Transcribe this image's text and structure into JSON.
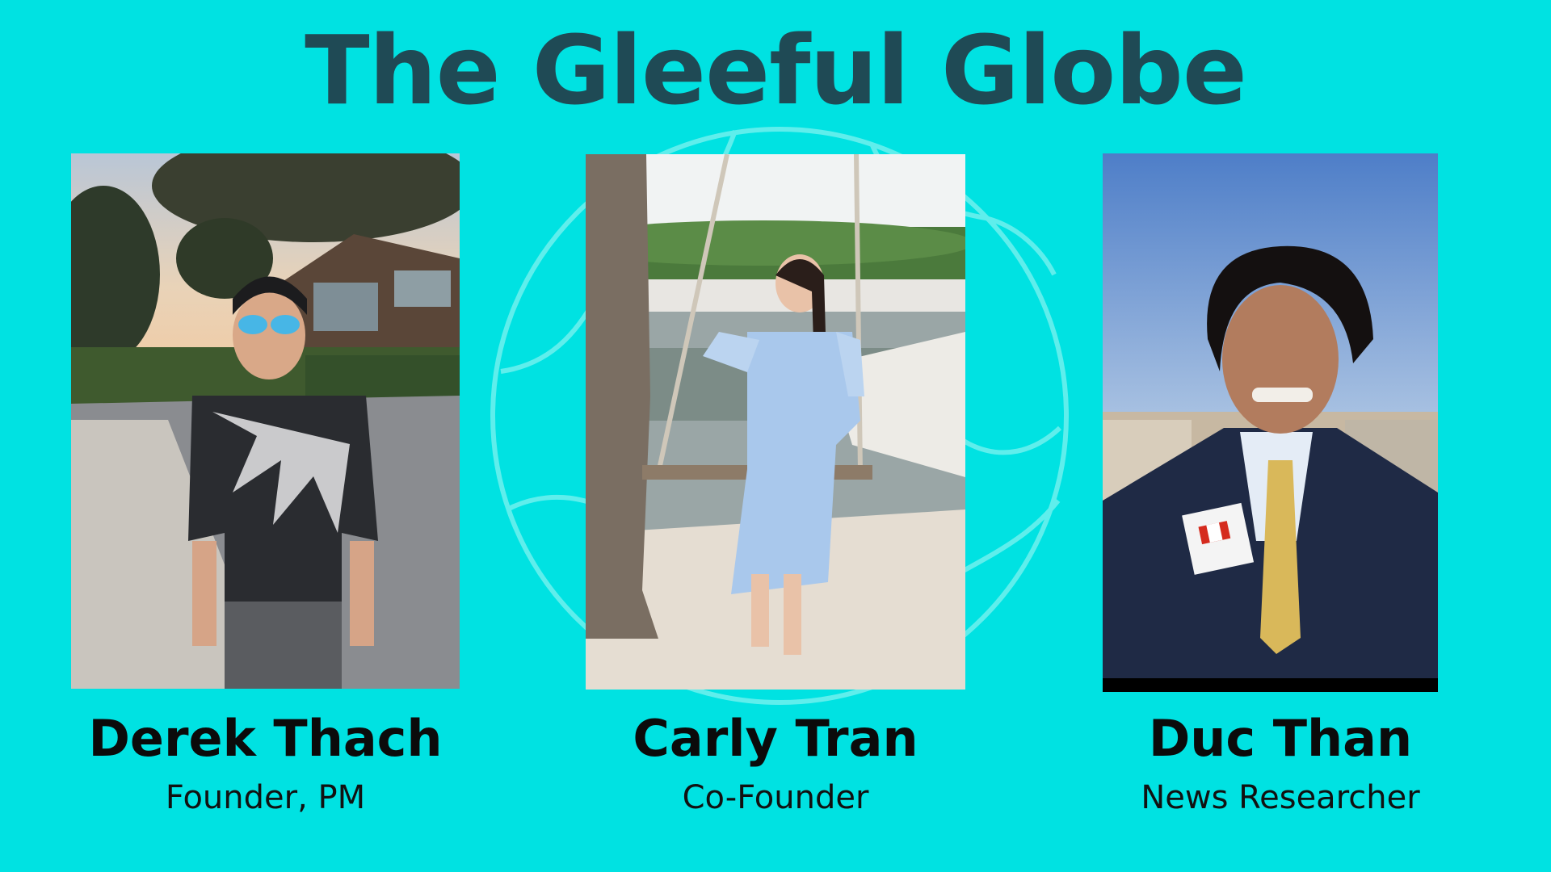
{
  "slide": {
    "title": "The Gleeful Globe",
    "background_color": "#00E2E2",
    "title_color": "#1F4A55",
    "globe_icon": "globe-icon"
  },
  "team": [
    {
      "name": "Derek Thach",
      "role": "Founder, PM"
    },
    {
      "name": "Carly Tran",
      "role": "Co-Founder"
    },
    {
      "name": "Duc Than",
      "role": "News Researcher"
    }
  ]
}
